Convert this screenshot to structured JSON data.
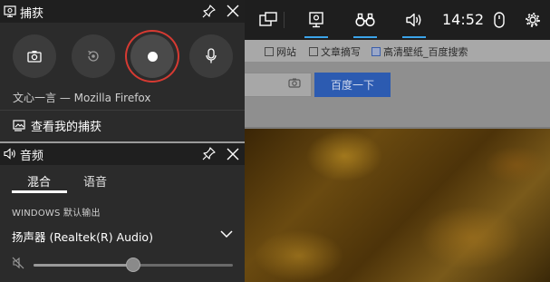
{
  "capture": {
    "title": "捕获",
    "source": "文心一言 — Mozilla Firefox",
    "gallery_label": "查看我的捕获"
  },
  "audio": {
    "title": "音频",
    "tabs": [
      "混合",
      "语音"
    ],
    "section_label": "WINDOWS 默认输出",
    "device": "扬声器 (Realtek(R) Audio)",
    "volume_fraction": 0.5
  },
  "topbar": {
    "time": "14:52",
    "accent": "#3ba4e9"
  },
  "browser_bg": {
    "bookmarks": [
      "网站",
      "文章摘写",
      "高清壁纸_百度搜索"
    ],
    "search_button": "百度一下"
  },
  "colors": {
    "record_ring": "#d63a32",
    "panel_bg": "#2b2b2b",
    "header_bg": "#1f1f1f"
  },
  "icons": {
    "capture_header": "camera-monitor-icon",
    "audio_header": "speaker-icon",
    "pin": "pin-icon",
    "close": "close-icon",
    "screenshot": "camera-icon",
    "last30": "replay-icon",
    "record": "record-icon",
    "mic": "microphone-icon",
    "gallery": "gallery-icon",
    "mute": "speaker-muted-icon",
    "chevron": "chevron-down-icon",
    "widgets": "widgets-icon",
    "capture_widget": "capture-widget-icon",
    "performance": "binoculars-icon",
    "audio_widget": "audio-widget-icon",
    "mouse": "mouse-icon",
    "settings": "gear-icon"
  }
}
